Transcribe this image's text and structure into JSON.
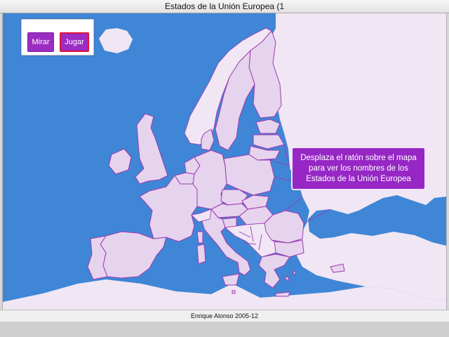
{
  "window": {
    "title": "Estados de la Unión Europea (1"
  },
  "controls": {
    "mirar_label": "Mirar",
    "jugar_label": "Jugar"
  },
  "info": {
    "text": "Desplaza el ratón sobre el mapa para ver los nombres de los Estados de la Unión Europea"
  },
  "footer": {
    "credit": "Enrique Alonso 2005-12"
  },
  "colors": {
    "sea": "#3f86d6",
    "land": "#f1e6f4",
    "eu_state": "#e6d3ee",
    "border": "#9b3bb0",
    "button": "#9b2dc2",
    "button_active_border": "#e0123b",
    "info_box": "#9627c4"
  }
}
